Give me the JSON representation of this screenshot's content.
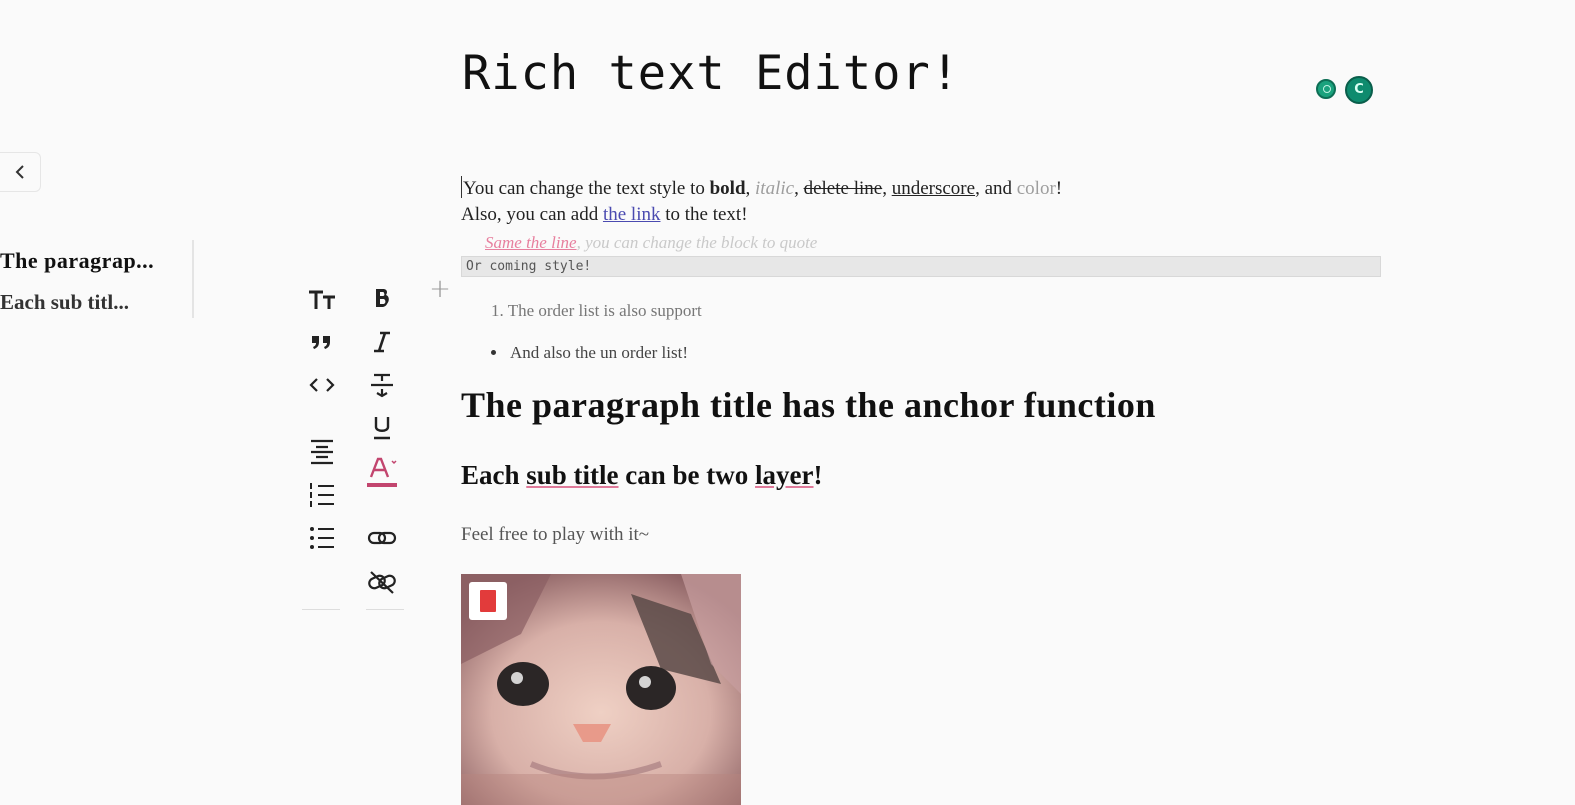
{
  "editor": {
    "title": "Rich text Editor!"
  },
  "collaborators": [
    {
      "initial": ""
    },
    {
      "initial": "C"
    }
  ],
  "toc": {
    "items": [
      {
        "label": "The paragrap...",
        "level": 2
      },
      {
        "label": "Each sub titl...",
        "level": 3
      }
    ]
  },
  "toolbar": {
    "left_column": [
      "text-size-icon",
      "quote-icon",
      "code-icon",
      "align-center-icon",
      "ordered-list-icon",
      "bullet-list-icon"
    ],
    "right_column": [
      "bold-icon",
      "italic-icon",
      "strikethrough-icon",
      "underline-icon",
      "font-color-icon",
      "link-icon",
      "unlink-icon"
    ],
    "add_label": "+"
  },
  "content": {
    "line1": {
      "prefix": "You can change the text style to ",
      "bold": "bold",
      "sep1": ", ",
      "italic": "italic",
      "sep2": ", ",
      "strike": "delete line",
      "sep3": ", ",
      "underline": "underscore",
      "sep4": ", and ",
      "color": "color",
      "suffix": "!"
    },
    "line2": {
      "prefix": "Also, you can add ",
      "link": "the link",
      "suffix": " to the text!"
    },
    "quote": {
      "highlight": "Same the line",
      "rest": ", you can change the block to quote"
    },
    "code": "Or coming style!",
    "ordered_item": {
      "number": "1.",
      "text": "The order list is also support"
    },
    "bullet_item": "And also the un order list!",
    "heading2": "The paragraph title has the anchor function",
    "heading3": {
      "before": "Each ",
      "w1": "sub title",
      "middle": " can be two ",
      "w2": "layer",
      "after": "!"
    },
    "paragraph": "Feel free to play with it~"
  },
  "colors": {
    "accent": "#0e8b6e",
    "font_color_bar": "#c2456e",
    "image_badge": "#e23b3b"
  }
}
